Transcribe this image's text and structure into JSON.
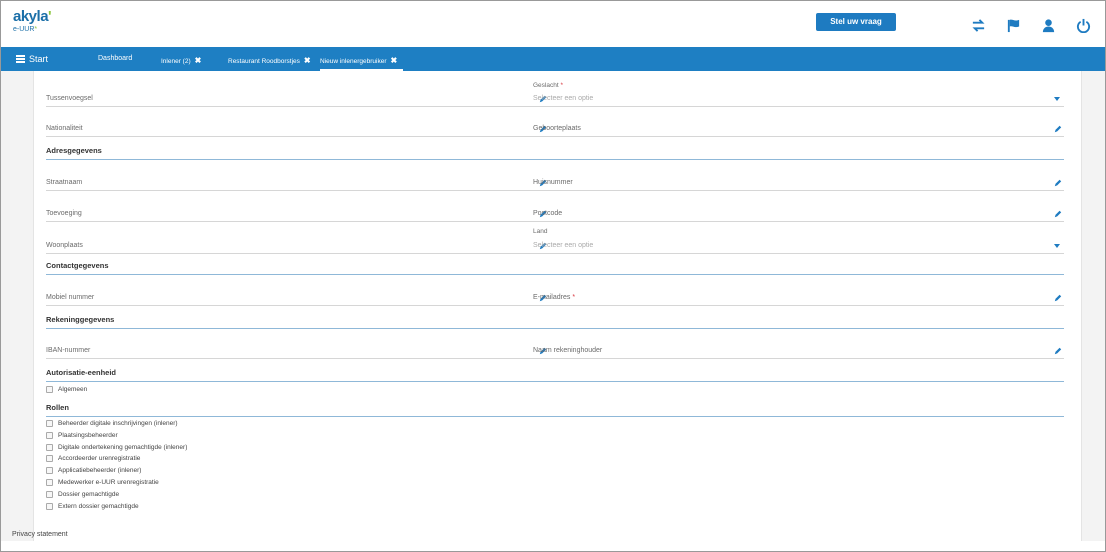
{
  "header": {
    "logo_main": "akyla",
    "logo_dot": "'",
    "logo_sub": "e-UUR",
    "logo_star": "*",
    "ask_button": "Stel uw vraag",
    "icons": [
      "transfer-icon",
      "flag-icon",
      "user-icon",
      "power-icon"
    ]
  },
  "nav": {
    "start": "Start",
    "dashboard": "Dashboard",
    "tabs": [
      {
        "label": "Inlener (2)"
      },
      {
        "label": "Restaurant Roodborstjes"
      },
      {
        "label": "Nieuw inlenergebruiker"
      }
    ],
    "close_glyph": "✖"
  },
  "form": {
    "tussenvoegsel": "Tussenvoegsel",
    "geslacht_label": "Geslacht",
    "geslacht_placeholder": "Selecteer een optie",
    "nationaliteit": "Nationaliteit",
    "geboorteplaats": "Geboorteplaats",
    "adres_section": "Adresgegevens",
    "straatnaam": "Straatnaam",
    "huisnummer": "Huisnummer",
    "toevoeging": "Toevoeging",
    "postcode": "Postcode",
    "woonplaats": "Woonplaats",
    "land_label": "Land",
    "land_placeholder": "Selecteer een optie",
    "contact_section": "Contactgegevens",
    "mobiel": "Mobiel nummer",
    "email": "E-mailadres",
    "rekening_section": "Rekeninggegevens",
    "iban": "IBAN-nummer",
    "rekeninghouder": "Naam rekeninghouder",
    "autorisatie_section": "Autorisatie-eenheid",
    "autorisatie_items": [
      "Algemeen"
    ],
    "rollen_section": "Rollen",
    "rollen_items": [
      "Beheerder digitale inschrijvingen (inlener)",
      "Plaatsingsbeheerder",
      "Digitale ondertekening gemachtigde (inlener)",
      "Accordeerder urenregistratie",
      "Applicatiebeheerder (inlener)",
      "Medewerker e-UUR urenregistratie",
      "Dossier gemachtigde",
      "Extern dossier gemachtigde"
    ],
    "required_mark": "*"
  },
  "footer": {
    "privacy": "Privacy statement"
  },
  "colors": {
    "accent": "#1e7fc3",
    "logo_green": "#8dc63f",
    "required": "#d9363e"
  }
}
